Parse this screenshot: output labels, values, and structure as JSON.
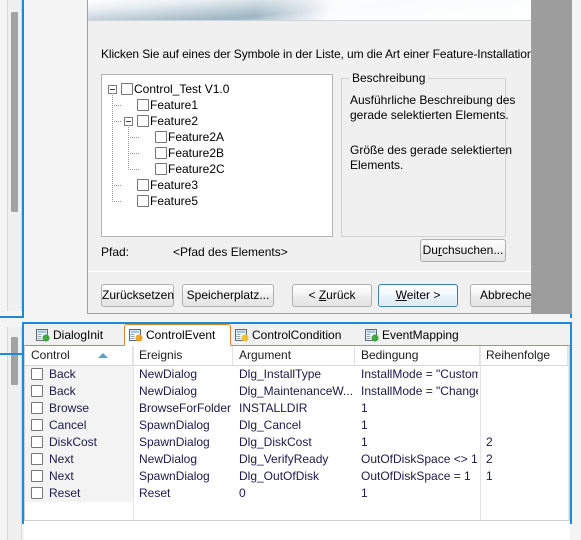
{
  "dialog": {
    "instruction": "Klicken Sie auf eines der Symbole in der Liste, um die Art einer Feature-Installation zu ändern.",
    "tree": [
      {
        "label": "Control_Test V1.0",
        "depth": 0,
        "expander": "minus"
      },
      {
        "label": "Feature1",
        "depth": 1,
        "expander": "none"
      },
      {
        "label": "Feature2",
        "depth": 1,
        "expander": "minus"
      },
      {
        "label": "Feature2A",
        "depth": 2,
        "expander": "none"
      },
      {
        "label": "Feature2B",
        "depth": 2,
        "expander": "none"
      },
      {
        "label": "Feature2C",
        "depth": 2,
        "expander": "none"
      },
      {
        "label": "Feature3",
        "depth": 1,
        "expander": "none"
      },
      {
        "label": "Feature5",
        "depth": 1,
        "expander": "none"
      }
    ],
    "description": {
      "legend": "Beschreibung",
      "line1": "Ausführliche Beschreibung des",
      "line2": "gerade selektierten Elements.",
      "line3": "Größe des gerade selektierten",
      "line4": "Elements."
    },
    "path": {
      "label": "Pfad:",
      "value": "<Pfad des Elements>"
    },
    "buttons": {
      "browse": {
        "pre": "Du",
        "mnemonic": "r",
        "post": "chsuchen..."
      },
      "reset": {
        "pre": "Zurücksetzen",
        "mnemonic": "",
        "post": ""
      },
      "diskcost": {
        "pre": "Speicherplatz...",
        "mnemonic": "",
        "post": ""
      },
      "back": {
        "pre": "< ",
        "mnemonic": "Z",
        "post": "urück"
      },
      "next": {
        "pre": "",
        "mnemonic": "W",
        "post": "eiter >"
      },
      "cancel": {
        "pre": "Abbrechen",
        "mnemonic": "",
        "post": ""
      }
    }
  },
  "tabs": [
    {
      "label": "DialogInit",
      "icon": "dialog-init-icon",
      "active": false
    },
    {
      "label": "ControlEvent",
      "icon": "control-event-icon",
      "active": true
    },
    {
      "label": "ControlCondition",
      "icon": "control-condition-icon",
      "active": false
    },
    {
      "label": "EventMapping",
      "icon": "event-mapping-icon",
      "active": false
    }
  ],
  "grid": {
    "columns": [
      {
        "label": "Control",
        "sort": "asc"
      },
      {
        "label": "Ereignis",
        "sort": ""
      },
      {
        "label": "Argument",
        "sort": ""
      },
      {
        "label": "Bedingung",
        "sort": ""
      },
      {
        "label": "Reihenfolge",
        "sort": ""
      }
    ],
    "rows": [
      {
        "control": "Back",
        "ereignis": "NewDialog",
        "argument": "Dlg_InstallType",
        "bedingung": "InstallMode = \"Custom\"",
        "reihenfolge": ""
      },
      {
        "control": "Back",
        "ereignis": "NewDialog",
        "argument": "Dlg_MaintenanceW...",
        "bedingung": "InstallMode = \"Change\"",
        "reihenfolge": ""
      },
      {
        "control": "Browse",
        "ereignis": "BrowseForFolder",
        "argument": "INSTALLDIR",
        "bedingung": "1",
        "reihenfolge": ""
      },
      {
        "control": "Cancel",
        "ereignis": "SpawnDialog",
        "argument": "Dlg_Cancel",
        "bedingung": "1",
        "reihenfolge": ""
      },
      {
        "control": "DiskCost",
        "ereignis": "SpawnDialog",
        "argument": "Dlg_DiskCost",
        "bedingung": "1",
        "reihenfolge": "2"
      },
      {
        "control": "Next",
        "ereignis": "NewDialog",
        "argument": "Dlg_VerifyReady",
        "bedingung": "OutOfDiskSpace <> 1",
        "reihenfolge": "2"
      },
      {
        "control": "Next",
        "ereignis": "SpawnDialog",
        "argument": "Dlg_OutOfDisk",
        "bedingung": "OutOfDiskSpace = 1",
        "reihenfolge": "1"
      },
      {
        "control": "Reset",
        "ereignis": "Reset",
        "argument": "0",
        "bedingung": "1",
        "reihenfolge": ""
      }
    ]
  },
  "colors": {
    "accent_blue": "#1e8ad6",
    "tab_active_border": "#e0862a",
    "sort_arrow": "#5a9fd4",
    "grid_text": "#1a1a4a"
  }
}
